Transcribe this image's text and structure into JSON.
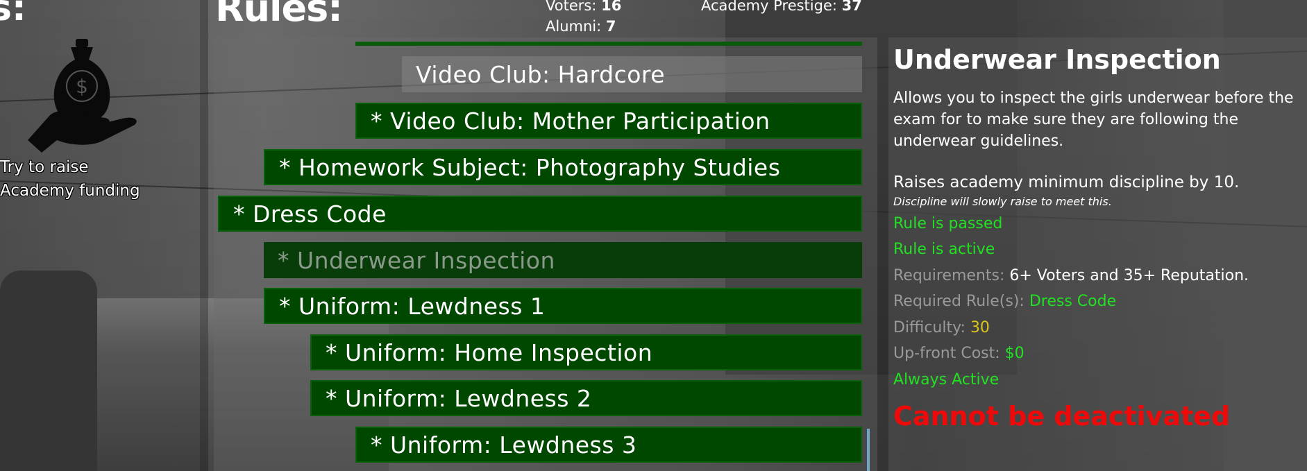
{
  "left": {
    "heading": "s:",
    "task_line1": "Try to raise",
    "task_line2": "Academy funding",
    "icon": "money-bag-hand-icon"
  },
  "header": {
    "title": "Rules:",
    "voters_label": "Voters:",
    "voters_value": "16",
    "alumni_label": "Alumni:",
    "alumni_value": "7",
    "prestige_label": "Academy Prestige:",
    "prestige_value": "37"
  },
  "rules": [
    {
      "label": "Video Club: Hardcore"
    },
    {
      "label": "* Video Club: Mother Participation"
    },
    {
      "label": "* Homework Subject: Photography Studies"
    },
    {
      "label": "* Dress Code"
    },
    {
      "label": "* Underwear Inspection"
    },
    {
      "label": "* Uniform: Lewdness 1"
    },
    {
      "label": "* Uniform: Home Inspection"
    },
    {
      "label": "* Uniform: Lewdness 2"
    },
    {
      "label": "* Uniform: Lewdness 3"
    }
  ],
  "detail": {
    "title": "Underwear Inspection",
    "description": "Allows you to inspect the girls underwear before the exam for to make sure they are following the underwear guidelines.",
    "effect": "Raises academy minimum discipline by 10.",
    "effect_note": "Discipline will slowly raise to meet this.",
    "status_passed": "Rule is passed",
    "status_active": "Rule is active",
    "requirements_label": "Requirements:",
    "requirements_value": "6+ Voters and 35+ Reputation.",
    "required_rules_label": "Required Rule(s):",
    "required_rules_value": "Dress Code",
    "difficulty_label": "Difficulty:",
    "difficulty_value": "30",
    "cost_label": "Up-front Cost:",
    "cost_value": "$0",
    "always_active": "Always Active",
    "warning": "Cannot be deactivated"
  },
  "colors": {
    "rule_green": "#004800",
    "status_green": "#22e022",
    "difficulty_yellow": "#d8c41a",
    "warning_red": "#ee0a0a"
  }
}
